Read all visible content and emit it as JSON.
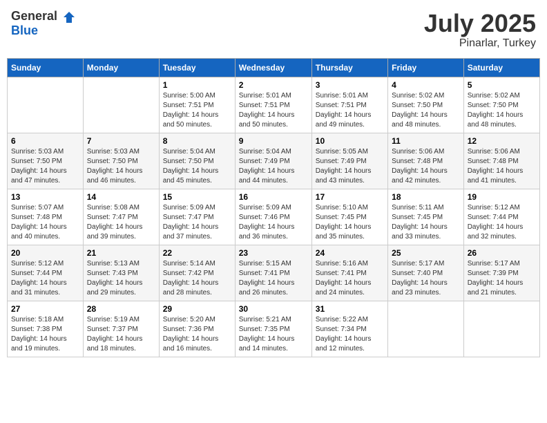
{
  "header": {
    "logo_general": "General",
    "logo_blue": "Blue",
    "month": "July 2025",
    "location": "Pinarlar, Turkey"
  },
  "days_of_week": [
    "Sunday",
    "Monday",
    "Tuesday",
    "Wednesday",
    "Thursday",
    "Friday",
    "Saturday"
  ],
  "weeks": [
    [
      {
        "day": "",
        "info": ""
      },
      {
        "day": "",
        "info": ""
      },
      {
        "day": "1",
        "info": "Sunrise: 5:00 AM\nSunset: 7:51 PM\nDaylight: 14 hours and 50 minutes."
      },
      {
        "day": "2",
        "info": "Sunrise: 5:01 AM\nSunset: 7:51 PM\nDaylight: 14 hours and 50 minutes."
      },
      {
        "day": "3",
        "info": "Sunrise: 5:01 AM\nSunset: 7:51 PM\nDaylight: 14 hours and 49 minutes."
      },
      {
        "day": "4",
        "info": "Sunrise: 5:02 AM\nSunset: 7:50 PM\nDaylight: 14 hours and 48 minutes."
      },
      {
        "day": "5",
        "info": "Sunrise: 5:02 AM\nSunset: 7:50 PM\nDaylight: 14 hours and 48 minutes."
      }
    ],
    [
      {
        "day": "6",
        "info": "Sunrise: 5:03 AM\nSunset: 7:50 PM\nDaylight: 14 hours and 47 minutes."
      },
      {
        "day": "7",
        "info": "Sunrise: 5:03 AM\nSunset: 7:50 PM\nDaylight: 14 hours and 46 minutes."
      },
      {
        "day": "8",
        "info": "Sunrise: 5:04 AM\nSunset: 7:50 PM\nDaylight: 14 hours and 45 minutes."
      },
      {
        "day": "9",
        "info": "Sunrise: 5:04 AM\nSunset: 7:49 PM\nDaylight: 14 hours and 44 minutes."
      },
      {
        "day": "10",
        "info": "Sunrise: 5:05 AM\nSunset: 7:49 PM\nDaylight: 14 hours and 43 minutes."
      },
      {
        "day": "11",
        "info": "Sunrise: 5:06 AM\nSunset: 7:48 PM\nDaylight: 14 hours and 42 minutes."
      },
      {
        "day": "12",
        "info": "Sunrise: 5:06 AM\nSunset: 7:48 PM\nDaylight: 14 hours and 41 minutes."
      }
    ],
    [
      {
        "day": "13",
        "info": "Sunrise: 5:07 AM\nSunset: 7:48 PM\nDaylight: 14 hours and 40 minutes."
      },
      {
        "day": "14",
        "info": "Sunrise: 5:08 AM\nSunset: 7:47 PM\nDaylight: 14 hours and 39 minutes."
      },
      {
        "day": "15",
        "info": "Sunrise: 5:09 AM\nSunset: 7:47 PM\nDaylight: 14 hours and 37 minutes."
      },
      {
        "day": "16",
        "info": "Sunrise: 5:09 AM\nSunset: 7:46 PM\nDaylight: 14 hours and 36 minutes."
      },
      {
        "day": "17",
        "info": "Sunrise: 5:10 AM\nSunset: 7:45 PM\nDaylight: 14 hours and 35 minutes."
      },
      {
        "day": "18",
        "info": "Sunrise: 5:11 AM\nSunset: 7:45 PM\nDaylight: 14 hours and 33 minutes."
      },
      {
        "day": "19",
        "info": "Sunrise: 5:12 AM\nSunset: 7:44 PM\nDaylight: 14 hours and 32 minutes."
      }
    ],
    [
      {
        "day": "20",
        "info": "Sunrise: 5:12 AM\nSunset: 7:44 PM\nDaylight: 14 hours and 31 minutes."
      },
      {
        "day": "21",
        "info": "Sunrise: 5:13 AM\nSunset: 7:43 PM\nDaylight: 14 hours and 29 minutes."
      },
      {
        "day": "22",
        "info": "Sunrise: 5:14 AM\nSunset: 7:42 PM\nDaylight: 14 hours and 28 minutes."
      },
      {
        "day": "23",
        "info": "Sunrise: 5:15 AM\nSunset: 7:41 PM\nDaylight: 14 hours and 26 minutes."
      },
      {
        "day": "24",
        "info": "Sunrise: 5:16 AM\nSunset: 7:41 PM\nDaylight: 14 hours and 24 minutes."
      },
      {
        "day": "25",
        "info": "Sunrise: 5:17 AM\nSunset: 7:40 PM\nDaylight: 14 hours and 23 minutes."
      },
      {
        "day": "26",
        "info": "Sunrise: 5:17 AM\nSunset: 7:39 PM\nDaylight: 14 hours and 21 minutes."
      }
    ],
    [
      {
        "day": "27",
        "info": "Sunrise: 5:18 AM\nSunset: 7:38 PM\nDaylight: 14 hours and 19 minutes."
      },
      {
        "day": "28",
        "info": "Sunrise: 5:19 AM\nSunset: 7:37 PM\nDaylight: 14 hours and 18 minutes."
      },
      {
        "day": "29",
        "info": "Sunrise: 5:20 AM\nSunset: 7:36 PM\nDaylight: 14 hours and 16 minutes."
      },
      {
        "day": "30",
        "info": "Sunrise: 5:21 AM\nSunset: 7:35 PM\nDaylight: 14 hours and 14 minutes."
      },
      {
        "day": "31",
        "info": "Sunrise: 5:22 AM\nSunset: 7:34 PM\nDaylight: 14 hours and 12 minutes."
      },
      {
        "day": "",
        "info": ""
      },
      {
        "day": "",
        "info": ""
      }
    ]
  ]
}
